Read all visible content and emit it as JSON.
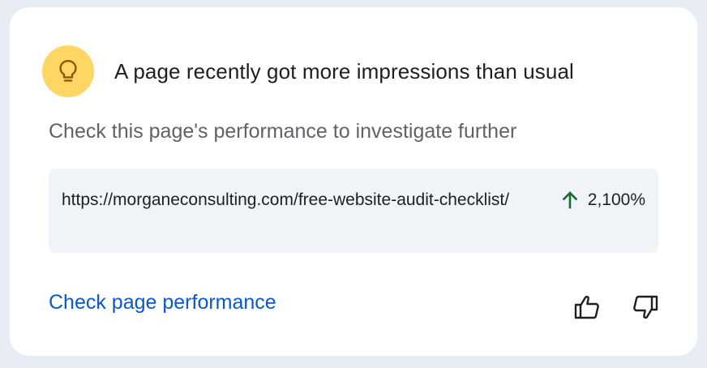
{
  "card": {
    "title": "A page recently got more impressions than usual",
    "subtitle": "Check this page's performance to investigate further",
    "icon": "lightbulb-icon",
    "icon_bg_color": "#fdd663",
    "icon_color": "#8a5a00"
  },
  "url_row": {
    "url": "https://morganeconsulting.com/free-website-audit-checklist/",
    "change": "2,100%",
    "change_icon": "arrow-up-icon",
    "change_color": "#146c2e"
  },
  "actions": {
    "primary_label": "Check page performance",
    "primary_color": "#0b57d0",
    "thumbs_up_icon": "thumbs-up-icon",
    "thumbs_down_icon": "thumbs-down-icon"
  }
}
